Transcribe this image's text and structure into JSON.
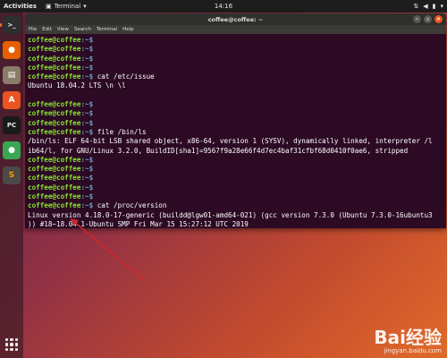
{
  "topbar": {
    "activities": "Activities",
    "app_name": "Terminal",
    "clock": "14:16"
  },
  "dock": {
    "items": [
      {
        "name": "terminal",
        "glyph": ">_",
        "color": "#2e2e2e"
      },
      {
        "name": "firefox",
        "glyph": "●",
        "color": "#e66000"
      },
      {
        "name": "files",
        "glyph": "▤",
        "color": "#8b7b68"
      },
      {
        "name": "software",
        "glyph": "A",
        "color": "#e95420"
      },
      {
        "name": "pycharm",
        "glyph": "PC",
        "color": "#1a1a1a"
      },
      {
        "name": "app-green",
        "glyph": "●",
        "color": "#3aa655"
      },
      {
        "name": "sublime",
        "glyph": "S",
        "color": "#4a4a4a"
      }
    ]
  },
  "terminal": {
    "title": "coffee@coffee: ~",
    "menu": [
      "File",
      "Edit",
      "View",
      "Search",
      "Terminal",
      "Help"
    ],
    "prompt_user": "coffee@coffee",
    "prompt_path": ":~$",
    "lines": [
      {
        "type": "prompt",
        "cmd": ""
      },
      {
        "type": "prompt",
        "cmd": ""
      },
      {
        "type": "prompt",
        "cmd": ""
      },
      {
        "type": "prompt",
        "cmd": ""
      },
      {
        "type": "prompt",
        "cmd": " cat /etc/issue"
      },
      {
        "type": "output",
        "text": "Ubuntu 18.04.2 LTS \\n \\l"
      },
      {
        "type": "output",
        "text": ""
      },
      {
        "type": "prompt",
        "cmd": ""
      },
      {
        "type": "prompt",
        "cmd": ""
      },
      {
        "type": "prompt",
        "cmd": ""
      },
      {
        "type": "prompt",
        "cmd": " file /bin/ls"
      },
      {
        "type": "output",
        "text": "/bin/ls: ELF 64-bit LSB shared object, x86-64, version 1 (SYSV), dynamically linked, interpreter /l"
      },
      {
        "type": "output",
        "text": "ib64/l, for GNU/Linux 3.2.0, BuildID[sha1]=9567f9a28e66f4d7ec4baf31cfbf68d0410f0ae6, stripped"
      },
      {
        "type": "prompt",
        "cmd": ""
      },
      {
        "type": "prompt",
        "cmd": ""
      },
      {
        "type": "prompt",
        "cmd": ""
      },
      {
        "type": "prompt",
        "cmd": ""
      },
      {
        "type": "prompt",
        "cmd": ""
      },
      {
        "type": "prompt",
        "cmd": " cat /proc/version"
      },
      {
        "type": "output",
        "text": "Linux version 4.18.0-17-generic (buildd@lgw01-amd64-021) (gcc version 7.3.0 (Ubuntu 7.3.0-16ubuntu3"
      },
      {
        "type": "output",
        "text": ")) #18~18.04.1-Ubuntu SMP Fri Mar 15 15:27:12 UTC 2019"
      },
      {
        "type": "prompt",
        "cmd": " ",
        "cursor": true
      }
    ]
  },
  "watermark": {
    "logo": "Bai经验",
    "url": "jingyan.baidu.com"
  },
  "colors": {
    "prompt": "#8ae234",
    "path": "#729fcf",
    "terminal_bg": "#2c0a23",
    "arrow": "#d0262a"
  }
}
